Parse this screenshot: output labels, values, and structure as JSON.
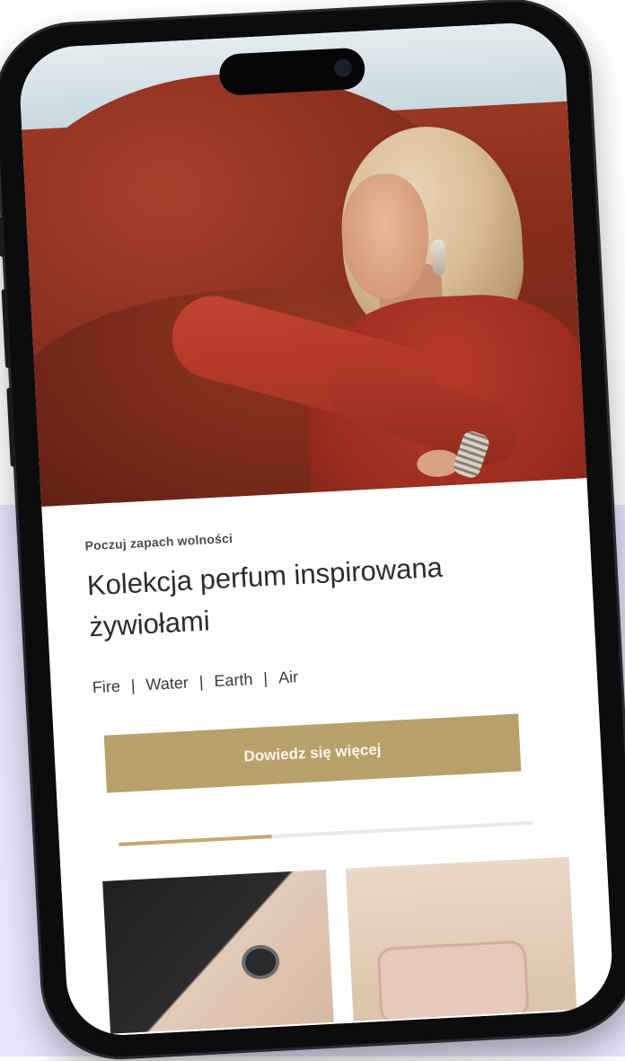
{
  "hero": {
    "eyebrow": "Poczuj zapach wolności",
    "headline": "Kolekcja perfum inspirowana żywiołami",
    "elements": [
      "Fire",
      "Water",
      "Earth",
      "Air"
    ],
    "separator": "|",
    "cta_label": "Dowiedz się więcej"
  },
  "carousel": {
    "progress": 0.37
  },
  "colors": {
    "accent": "#b8a06a",
    "background_band": "#e7e3fb",
    "text": "#2c2c2c"
  }
}
